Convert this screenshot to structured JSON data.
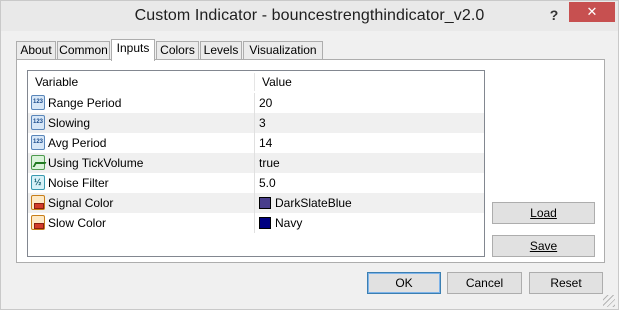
{
  "window": {
    "title": "Custom Indicator - bouncestrengthindicator_v2.0",
    "help_label": "?",
    "close_label": "✕"
  },
  "tabs": [
    {
      "label": "About",
      "active": false
    },
    {
      "label": "Common",
      "active": false
    },
    {
      "label": "Inputs",
      "active": true
    },
    {
      "label": "Colors",
      "active": false
    },
    {
      "label": "Levels",
      "active": false
    },
    {
      "label": "Visualization",
      "active": false
    }
  ],
  "grid": {
    "headers": {
      "variable": "Variable",
      "value": "Value"
    },
    "rows": [
      {
        "icon": "int-type-icon",
        "variable": "Range Period",
        "value": "20"
      },
      {
        "icon": "int-type-icon",
        "variable": "Slowing",
        "value": "3"
      },
      {
        "icon": "int-type-icon",
        "variable": "Avg Period",
        "value": "14"
      },
      {
        "icon": "bool-type-icon",
        "variable": "Using TickVolume",
        "value": "true"
      },
      {
        "icon": "double-type-icon",
        "variable": "Noise Filter",
        "value": "5.0"
      },
      {
        "icon": "color-type-icon",
        "variable": "Signal Color",
        "value": "DarkSlateBlue",
        "swatch": "#483d8b"
      },
      {
        "icon": "color-type-icon",
        "variable": "Slow Color",
        "value": "Navy",
        "swatch": "#000080"
      }
    ]
  },
  "side_buttons": {
    "load": "Load",
    "save": "Save"
  },
  "footer_buttons": {
    "ok": "OK",
    "cancel": "Cancel",
    "reset": "Reset"
  }
}
